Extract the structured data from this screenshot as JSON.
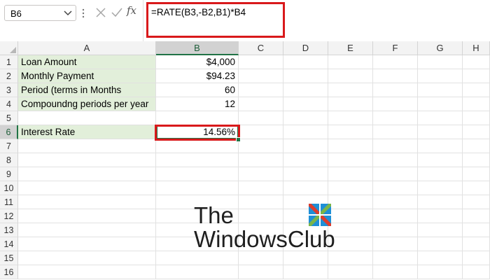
{
  "name_box": {
    "value": "B6",
    "icon": "chevron-down-icon"
  },
  "formula_bar": {
    "cancel_icon": "cancel-icon",
    "enter_icon": "check-icon",
    "fx_label": "fx",
    "formula": "=RATE(B3,-B2,B1)*B4",
    "highlight_color": "#d9191b"
  },
  "columns": [
    "A",
    "B",
    "C",
    "D",
    "E",
    "F",
    "G",
    "H"
  ],
  "selected_column": "B",
  "rows": [
    "1",
    "2",
    "3",
    "4",
    "5",
    "6",
    "7",
    "8",
    "9",
    "10",
    "11",
    "12",
    "13",
    "14",
    "15",
    "16"
  ],
  "selected_row": "6",
  "cells": {
    "A1": "Loan Amount",
    "B1": "$4,000",
    "A2": "Monthly Payment",
    "B2": "$94.23",
    "A3": "Period (terms in Months",
    "B3": "60",
    "A4": "Compoundng periods per year",
    "B4": "12",
    "A6": "Interest Rate",
    "B6": "14.56%"
  },
  "colors": {
    "label_fill": "#e2efda",
    "selection_green": "#217346",
    "annotation_red": "#d9191b"
  },
  "watermark": {
    "line1": "The",
    "line2": "WindowsClub",
    "logo_icon": "windows-logo-icon"
  }
}
